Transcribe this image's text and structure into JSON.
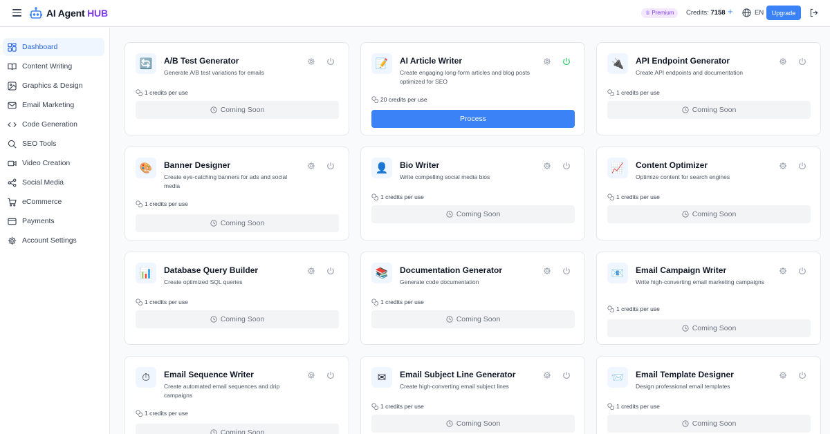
{
  "header": {
    "brand_main": "AI Agent",
    "brand_accent": "HUB",
    "premium_badge": "♕ Premium",
    "credits_label": "Credits:",
    "credits_value": "7158",
    "plus": "+",
    "language": "EN",
    "upgrade_label": "Upgrade"
  },
  "colors": {
    "accent": "#3b82f6",
    "brand_purple": "#7c3aed",
    "active_power": "#22c55e"
  },
  "sidebar": {
    "items": [
      {
        "label": "Dashboard",
        "icon": "dashboard-icon",
        "active": true
      },
      {
        "label": "Content Writing",
        "icon": "book-icon"
      },
      {
        "label": "Graphics & Design",
        "icon": "image-icon"
      },
      {
        "label": "Email Marketing",
        "icon": "mail-icon"
      },
      {
        "label": "Code Generation",
        "icon": "code-icon"
      },
      {
        "label": "SEO Tools",
        "icon": "search-icon"
      },
      {
        "label": "Video Creation",
        "icon": "video-icon"
      },
      {
        "label": "Social Media",
        "icon": "share-icon"
      },
      {
        "label": "eCommerce",
        "icon": "cart-icon"
      },
      {
        "label": "Payments",
        "icon": "credit-card-icon"
      },
      {
        "label": "Account Settings",
        "icon": "gear-icon"
      }
    ]
  },
  "cards": [
    {
      "title": "A/B Test Generator",
      "desc": "Generate A/B test variations for emails",
      "credits": "1 credits per use",
      "button": "Coming Soon",
      "emoji": "🔄",
      "icon": "ab-test-icon"
    },
    {
      "title": "AI Article Writer",
      "desc": "Create engaging long-form articles and blog posts optimized for SEO",
      "credits": "20 credits per use",
      "button": "Process",
      "emoji": "📝",
      "icon": "article-icon",
      "active": true
    },
    {
      "title": "API Endpoint Generator",
      "desc": "Create API endpoints and documentation",
      "credits": "1 credits per use",
      "button": "Coming Soon",
      "emoji": "🔌",
      "icon": "plug-icon"
    },
    {
      "title": "Banner Designer",
      "desc": "Create eye-catching banners for ads and social media",
      "credits": "1 credits per use",
      "button": "Coming Soon",
      "emoji": "🎨",
      "icon": "palette-icon"
    },
    {
      "title": "Bio Writer",
      "desc": "Write compelling social media bios",
      "credits": "1 credits per use",
      "button": "Coming Soon",
      "emoji": "👤",
      "icon": "user-icon"
    },
    {
      "title": "Content Optimizer",
      "desc": "Optimize content for search engines",
      "credits": "1 credits per use",
      "button": "Coming Soon",
      "emoji": "📈",
      "icon": "chart-up-icon"
    },
    {
      "title": "Database Query Builder",
      "desc": "Create optimized SQL queries",
      "credits": "1 credits per use",
      "button": "Coming Soon",
      "emoji": "📊",
      "icon": "bar-chart-icon"
    },
    {
      "title": "Documentation Generator",
      "desc": "Generate code documentation",
      "credits": "1 credits per use",
      "button": "Coming Soon",
      "emoji": "📚",
      "icon": "books-icon"
    },
    {
      "title": "Email Campaign Writer",
      "desc": "Write high-converting email marketing campaigns",
      "credits": "1 credits per use",
      "button": "Coming Soon",
      "emoji": "📧",
      "icon": "email-icon"
    },
    {
      "title": "Email Sequence Writer",
      "desc": "Create automated email sequences and drip campaigns",
      "credits": "1 credits per use",
      "button": "Coming Soon",
      "emoji": "⏱",
      "icon": "stopwatch-icon"
    },
    {
      "title": "Email Subject Line Generator",
      "desc": "Create high-converting email subject lines",
      "credits": "1 credits per use",
      "button": "Coming Soon",
      "emoji": "✉",
      "icon": "envelope-icon"
    },
    {
      "title": "Email Template Designer",
      "desc": "Design professional email templates",
      "credits": "1 credits per use",
      "button": "Coming Soon",
      "emoji": "📨",
      "icon": "incoming-envelope-icon"
    }
  ]
}
